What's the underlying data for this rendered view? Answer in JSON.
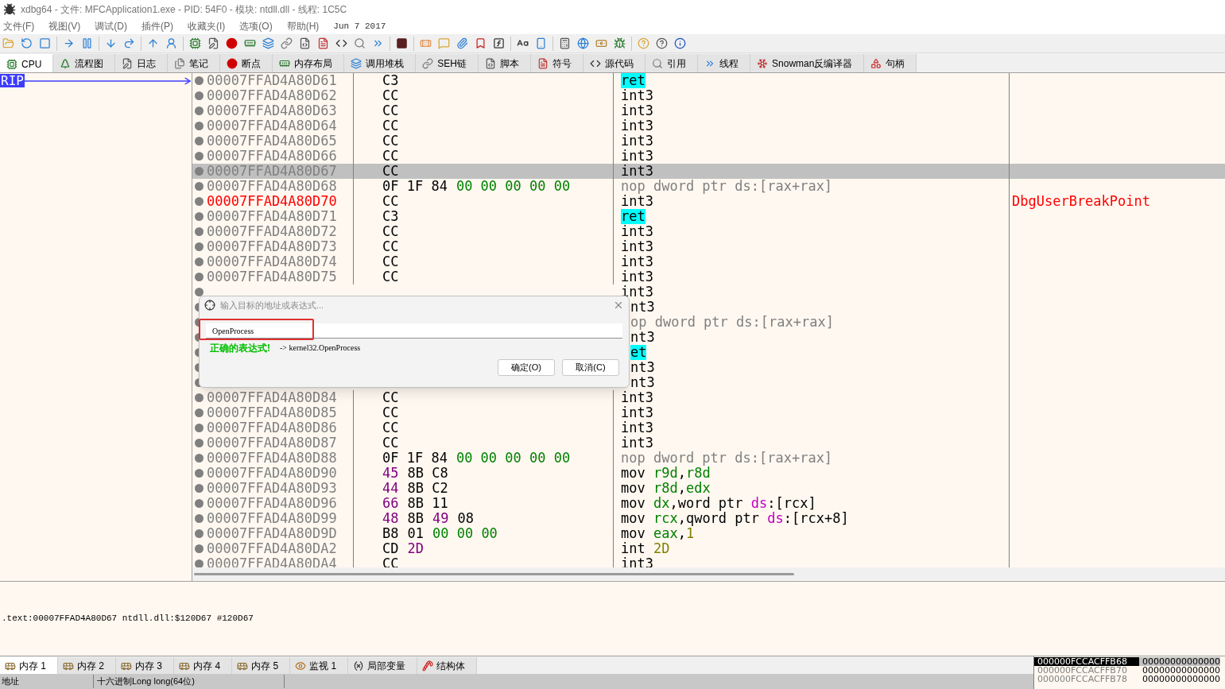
{
  "window": {
    "title": "xdbg64 - 文件: MFCApplication1.exe - PID: 54F0 - 模块: ntdll.dll - 线程: 1C5C"
  },
  "menu": [
    "文件(F)",
    "视图(V)",
    "调试(D)",
    "插件(P)",
    "收藏夹(I)",
    "选项(O)",
    "帮助(H)"
  ],
  "build_date": "Jun 7 2017",
  "tabs": [
    {
      "label": "CPU",
      "selected": true
    },
    {
      "label": "流程图",
      "selected": false
    },
    {
      "label": "日志",
      "selected": false
    },
    {
      "label": "笔记",
      "selected": false
    },
    {
      "label": "断点",
      "selected": false
    },
    {
      "label": "内存布局",
      "selected": false
    },
    {
      "label": "调用堆栈",
      "selected": false
    },
    {
      "label": "SEH链",
      "selected": false
    },
    {
      "label": "脚本",
      "selected": false
    },
    {
      "label": "符号",
      "selected": false
    },
    {
      "label": "源代码",
      "selected": false
    },
    {
      "label": "引用",
      "selected": false
    },
    {
      "label": "线程",
      "selected": false
    },
    {
      "label": "Snowman反编译器",
      "selected": false
    },
    {
      "label": "句柄",
      "selected": false
    }
  ],
  "rip_label": "RIP",
  "rows": [
    {
      "kind": "line",
      "address": "00007FFAD4A80D61",
      "selected": false,
      "bytes": [
        {
          "text": "C3",
          "kind": "op"
        }
      ],
      "disasm": [
        {
          "text": "ret",
          "kind": "ret"
        }
      ]
    },
    {
      "kind": "line",
      "address": "00007FFAD4A80D62",
      "selected": false,
      "bytes": [
        {
          "text": "CC",
          "kind": "op"
        }
      ],
      "disasm": [
        {
          "text": "int3",
          "kind": "plain"
        }
      ]
    },
    {
      "kind": "line",
      "address": "00007FFAD4A80D63",
      "selected": false,
      "bytes": [
        {
          "text": "CC",
          "kind": "op"
        }
      ],
      "disasm": [
        {
          "text": "int3",
          "kind": "plain"
        }
      ]
    },
    {
      "kind": "line",
      "address": "00007FFAD4A80D64",
      "selected": false,
      "bytes": [
        {
          "text": "CC",
          "kind": "op"
        }
      ],
      "disasm": [
        {
          "text": "int3",
          "kind": "plain"
        }
      ]
    },
    {
      "kind": "line",
      "address": "00007FFAD4A80D65",
      "selected": false,
      "bytes": [
        {
          "text": "CC",
          "kind": "op"
        }
      ],
      "disasm": [
        {
          "text": "int3",
          "kind": "plain"
        }
      ]
    },
    {
      "kind": "line",
      "address": "00007FFAD4A80D66",
      "selected": false,
      "bytes": [
        {
          "text": "CC",
          "kind": "op"
        }
      ],
      "disasm": [
        {
          "text": "int3",
          "kind": "plain"
        }
      ]
    },
    {
      "kind": "line",
      "address": "00007FFAD4A80D67",
      "selected": true,
      "bytes": [
        {
          "text": "CC",
          "kind": "op"
        }
      ],
      "disasm": [
        {
          "text": "int3",
          "kind": "plain"
        }
      ]
    },
    {
      "kind": "line",
      "address": "00007FFAD4A80D68",
      "selected": false,
      "bytes": [
        {
          "text": "0F 1F 84",
          "kind": "op"
        },
        {
          "text": "00 00 00 00 00",
          "kind": "zero"
        }
      ],
      "disasm": [
        {
          "text": "nop dword ptr ds:[rax+rax]",
          "kind": "nop"
        }
      ]
    },
    {
      "kind": "line",
      "address": "00007FFAD4A80D70",
      "color": "#ff0000",
      "selected": false,
      "bytes": [
        {
          "text": "CC",
          "kind": "op"
        }
      ],
      "disasm": [
        {
          "text": "int3",
          "kind": "plain"
        }
      ],
      "comment": "DbgUserBreakPoint"
    },
    {
      "kind": "line",
      "address": "00007FFAD4A80D71",
      "selected": false,
      "bytes": [
        {
          "text": "C3",
          "kind": "op"
        }
      ],
      "disasm": [
        {
          "text": "ret",
          "kind": "ret"
        }
      ]
    },
    {
      "kind": "line",
      "address": "00007FFAD4A80D72",
      "selected": false,
      "bytes": [
        {
          "text": "CC",
          "kind": "op"
        }
      ],
      "disasm": [
        {
          "text": "int3",
          "kind": "plain"
        }
      ]
    },
    {
      "kind": "line",
      "address": "00007FFAD4A80D73",
      "selected": false,
      "bytes": [
        {
          "text": "CC",
          "kind": "op"
        }
      ],
      "disasm": [
        {
          "text": "int3",
          "kind": "plain"
        }
      ]
    },
    {
      "kind": "line",
      "address": "00007FFAD4A80D74",
      "selected": false,
      "bytes": [
        {
          "text": "CC",
          "kind": "op"
        }
      ],
      "disasm": [
        {
          "text": "int3",
          "kind": "plain"
        }
      ]
    },
    {
      "kind": "line",
      "address": "00007FFAD4A80D75",
      "selected": false,
      "bytes": [
        {
          "text": "CC",
          "kind": "op"
        }
      ],
      "disasm": [
        {
          "text": "int3",
          "kind": "plain"
        }
      ]
    },
    {
      "kind": "cut",
      "selected": false,
      "disasm": [
        {
          "text": "int3",
          "kind": "plain"
        }
      ]
    },
    {
      "kind": "covered",
      "selected": false,
      "disasm": [
        {
          "text": "nt3",
          "kind": "plain"
        }
      ]
    },
    {
      "kind": "covered",
      "selected": false,
      "disasm": [
        {
          "text": "op dword ptr ds:[rax+rax]",
          "kind": "nop"
        }
      ]
    },
    {
      "kind": "covered",
      "selected": false,
      "disasm": [
        {
          "text": "nt3",
          "kind": "plain"
        }
      ]
    },
    {
      "kind": "covered",
      "selected": false,
      "disasm": [
        {
          "text": "et",
          "kind": "ret"
        }
      ]
    },
    {
      "kind": "covered",
      "selected": false,
      "disasm": [
        {
          "text": "nt3",
          "kind": "plain"
        }
      ]
    },
    {
      "kind": "covered",
      "selected": false,
      "disasm": [
        {
          "text": "nt3",
          "kind": "plain"
        }
      ]
    },
    {
      "kind": "line",
      "address": "00007FFAD4A80D84",
      "selected": false,
      "bytes": [
        {
          "text": "CC",
          "kind": "op"
        }
      ],
      "disasm": [
        {
          "text": "int3",
          "kind": "plain"
        }
      ]
    },
    {
      "kind": "line",
      "address": "00007FFAD4A80D85",
      "selected": false,
      "bytes": [
        {
          "text": "CC",
          "kind": "op"
        }
      ],
      "disasm": [
        {
          "text": "int3",
          "kind": "plain"
        }
      ]
    },
    {
      "kind": "line",
      "address": "00007FFAD4A80D86",
      "selected": false,
      "bytes": [
        {
          "text": "CC",
          "kind": "op"
        }
      ],
      "disasm": [
        {
          "text": "int3",
          "kind": "plain"
        }
      ]
    },
    {
      "kind": "line",
      "address": "00007FFAD4A80D87",
      "selected": false,
      "bytes": [
        {
          "text": "CC",
          "kind": "op"
        }
      ],
      "disasm": [
        {
          "text": "int3",
          "kind": "plain"
        }
      ]
    },
    {
      "kind": "line",
      "address": "00007FFAD4A80D88",
      "selected": false,
      "bytes": [
        {
          "text": "0F 1F 84",
          "kind": "op"
        },
        {
          "text": "00 00 00 00 00",
          "kind": "zero"
        }
      ],
      "disasm": [
        {
          "text": "nop dword ptr ds:[rax+rax]",
          "kind": "nop"
        }
      ]
    },
    {
      "kind": "line",
      "address": "00007FFAD4A80D90",
      "selected": false,
      "bytes": [
        {
          "text": "45",
          "kind": "prefix"
        },
        {
          "text": "8B C8",
          "kind": "op"
        }
      ],
      "disasm": [
        {
          "text": "mov ",
          "kind": "plain"
        },
        {
          "text": "r9d",
          "kind": "reg"
        },
        {
          "text": ",",
          "kind": "plain"
        },
        {
          "text": "r8d",
          "kind": "reg"
        }
      ]
    },
    {
      "kind": "line",
      "address": "00007FFAD4A80D93",
      "selected": false,
      "bytes": [
        {
          "text": "44",
          "kind": "prefix"
        },
        {
          "text": "8B C2",
          "kind": "op"
        }
      ],
      "disasm": [
        {
          "text": "mov ",
          "kind": "plain"
        },
        {
          "text": "r8d",
          "kind": "reg"
        },
        {
          "text": ",",
          "kind": "plain"
        },
        {
          "text": "edx",
          "kind": "reg"
        }
      ]
    },
    {
      "kind": "line",
      "address": "00007FFAD4A80D96",
      "selected": false,
      "bytes": [
        {
          "text": "66",
          "kind": "prefix"
        },
        {
          "text": "8B 11",
          "kind": "op"
        }
      ],
      "disasm": [
        {
          "text": "mov ",
          "kind": "plain"
        },
        {
          "text": "dx",
          "kind": "reg"
        },
        {
          "text": ",word ptr ",
          "kind": "plain"
        },
        {
          "text": "ds",
          "kind": "seg"
        },
        {
          "text": ":[rcx]",
          "kind": "plain"
        }
      ]
    },
    {
      "kind": "line",
      "address": "00007FFAD4A80D99",
      "selected": false,
      "bytes": [
        {
          "text": "48",
          "kind": "prefix"
        },
        {
          "text": "8B",
          "kind": "op"
        },
        {
          "text": "49",
          "kind": "prefix"
        },
        {
          "text": "08",
          "kind": "op"
        }
      ],
      "disasm": [
        {
          "text": "mov ",
          "kind": "plain"
        },
        {
          "text": "rcx",
          "kind": "reg"
        },
        {
          "text": ",qword ptr ",
          "kind": "plain"
        },
        {
          "text": "ds",
          "kind": "seg"
        },
        {
          "text": ":[rcx+8]",
          "kind": "plain"
        }
      ]
    },
    {
      "kind": "line",
      "address": "00007FFAD4A80D9D",
      "selected": false,
      "bytes": [
        {
          "text": "B8",
          "kind": "op"
        },
        {
          "text": "01",
          "kind": "op"
        },
        {
          "text": "00 00 00",
          "kind": "zero"
        }
      ],
      "disasm": [
        {
          "text": "mov ",
          "kind": "plain"
        },
        {
          "text": "eax",
          "kind": "reg"
        },
        {
          "text": ",",
          "kind": "plain"
        },
        {
          "text": "1",
          "kind": "imm"
        }
      ]
    },
    {
      "kind": "line",
      "address": "00007FFAD4A80DA2",
      "selected": false,
      "bytes": [
        {
          "text": "CD",
          "kind": "op"
        },
        {
          "text": "2D",
          "kind": "prefix"
        }
      ],
      "disasm": [
        {
          "text": "int ",
          "kind": "plain"
        },
        {
          "text": "2D",
          "kind": "imm"
        }
      ]
    },
    {
      "kind": "line",
      "address": "00007FFAD4A80DA4",
      "selected": false,
      "bytes": [
        {
          "text": "CC",
          "kind": "op"
        }
      ],
      "disasm": [
        {
          "text": "int3",
          "kind": "plain"
        }
      ]
    }
  ],
  "info_line": ".text:00007FFAD4A80D67 ntdll.dll:$120D67 #120D67",
  "bottom_tabs": [
    {
      "label": "内存 1",
      "selected": true
    },
    {
      "label": "内存 2",
      "selected": false
    },
    {
      "label": "内存 3",
      "selected": false
    },
    {
      "label": "内存 4",
      "selected": false
    },
    {
      "label": "内存 5",
      "selected": false
    },
    {
      "label": "监视 1",
      "selected": false
    },
    {
      "label": "局部变量",
      "selected": false
    },
    {
      "label": "结构体",
      "selected": false
    }
  ],
  "dump_columns": [
    "地址",
    "十六进制Long long(64位)"
  ],
  "stack": [
    {
      "address": "000000FCCACFFB68",
      "value": "00000000000000",
      "selected": true
    },
    {
      "address": "000000FCCACFFB70",
      "value": "00000000000000",
      "selected": false
    },
    {
      "address": "000000FCCACFFB78",
      "value": "00000000000000",
      "selected": false
    }
  ],
  "dialog": {
    "title": "输入目标的地址或表达式...",
    "value": "OpenProcess",
    "status": "正确的表达式!",
    "result": "-> kernel32.OpenProcess",
    "buttons": [
      "确定(O)",
      "取消(C)"
    ]
  }
}
